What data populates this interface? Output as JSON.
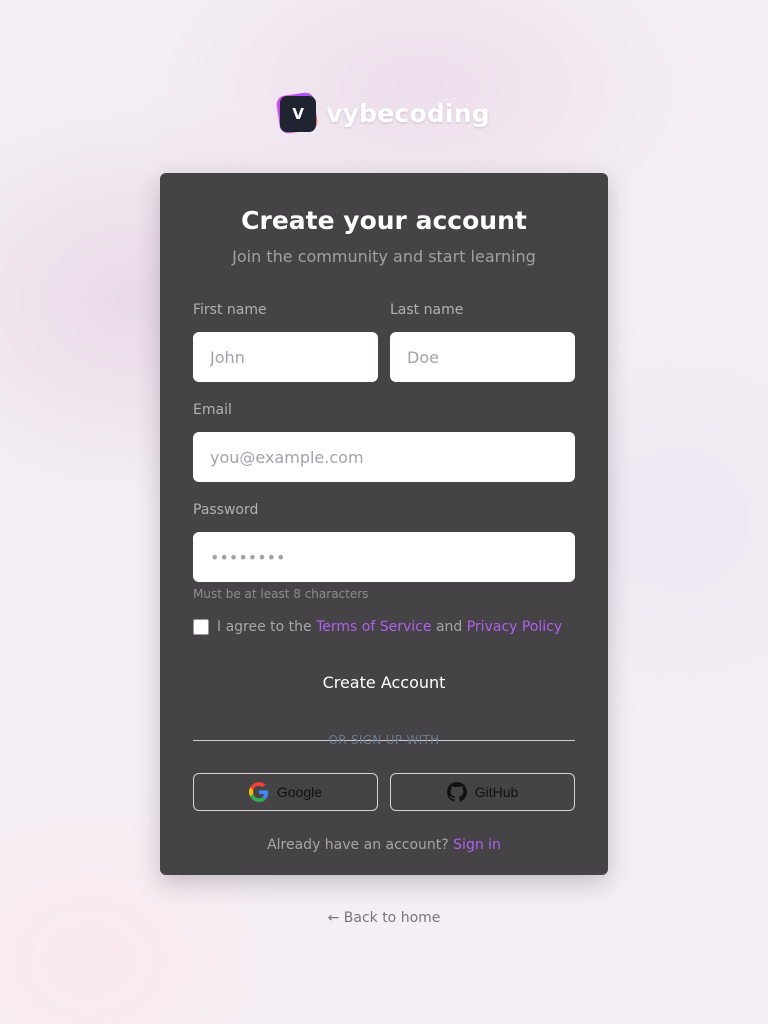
{
  "brand": {
    "logo_letter": "V",
    "name": "vybecoding"
  },
  "card": {
    "title": "Create your account",
    "subtitle": "Join the community and start learning"
  },
  "form": {
    "first_name": {
      "label": "First name",
      "placeholder": "John",
      "value": ""
    },
    "last_name": {
      "label": "Last name",
      "placeholder": "Doe",
      "value": ""
    },
    "email": {
      "label": "Email",
      "placeholder": "you@example.com",
      "value": ""
    },
    "password": {
      "label": "Password",
      "placeholder": "••••••••",
      "value": "",
      "hint": "Must be at least 8 characters"
    },
    "agree": {
      "checked": false,
      "prefix": "I agree to the",
      "terms": "Terms of Service",
      "and": "and",
      "privacy": "Privacy Policy"
    },
    "submit_label": "Create Account"
  },
  "divider_text": "OR SIGN UP WITH",
  "socials": {
    "google": {
      "label": "Google",
      "icon": "google-icon"
    },
    "github": {
      "label": "GitHub",
      "icon": "github-icon"
    }
  },
  "signin": {
    "prompt": "Already have an account?",
    "link": "Sign in"
  },
  "back_link": "← Back to home",
  "colors": {
    "accent": "#b061f0",
    "card": "#454345"
  }
}
